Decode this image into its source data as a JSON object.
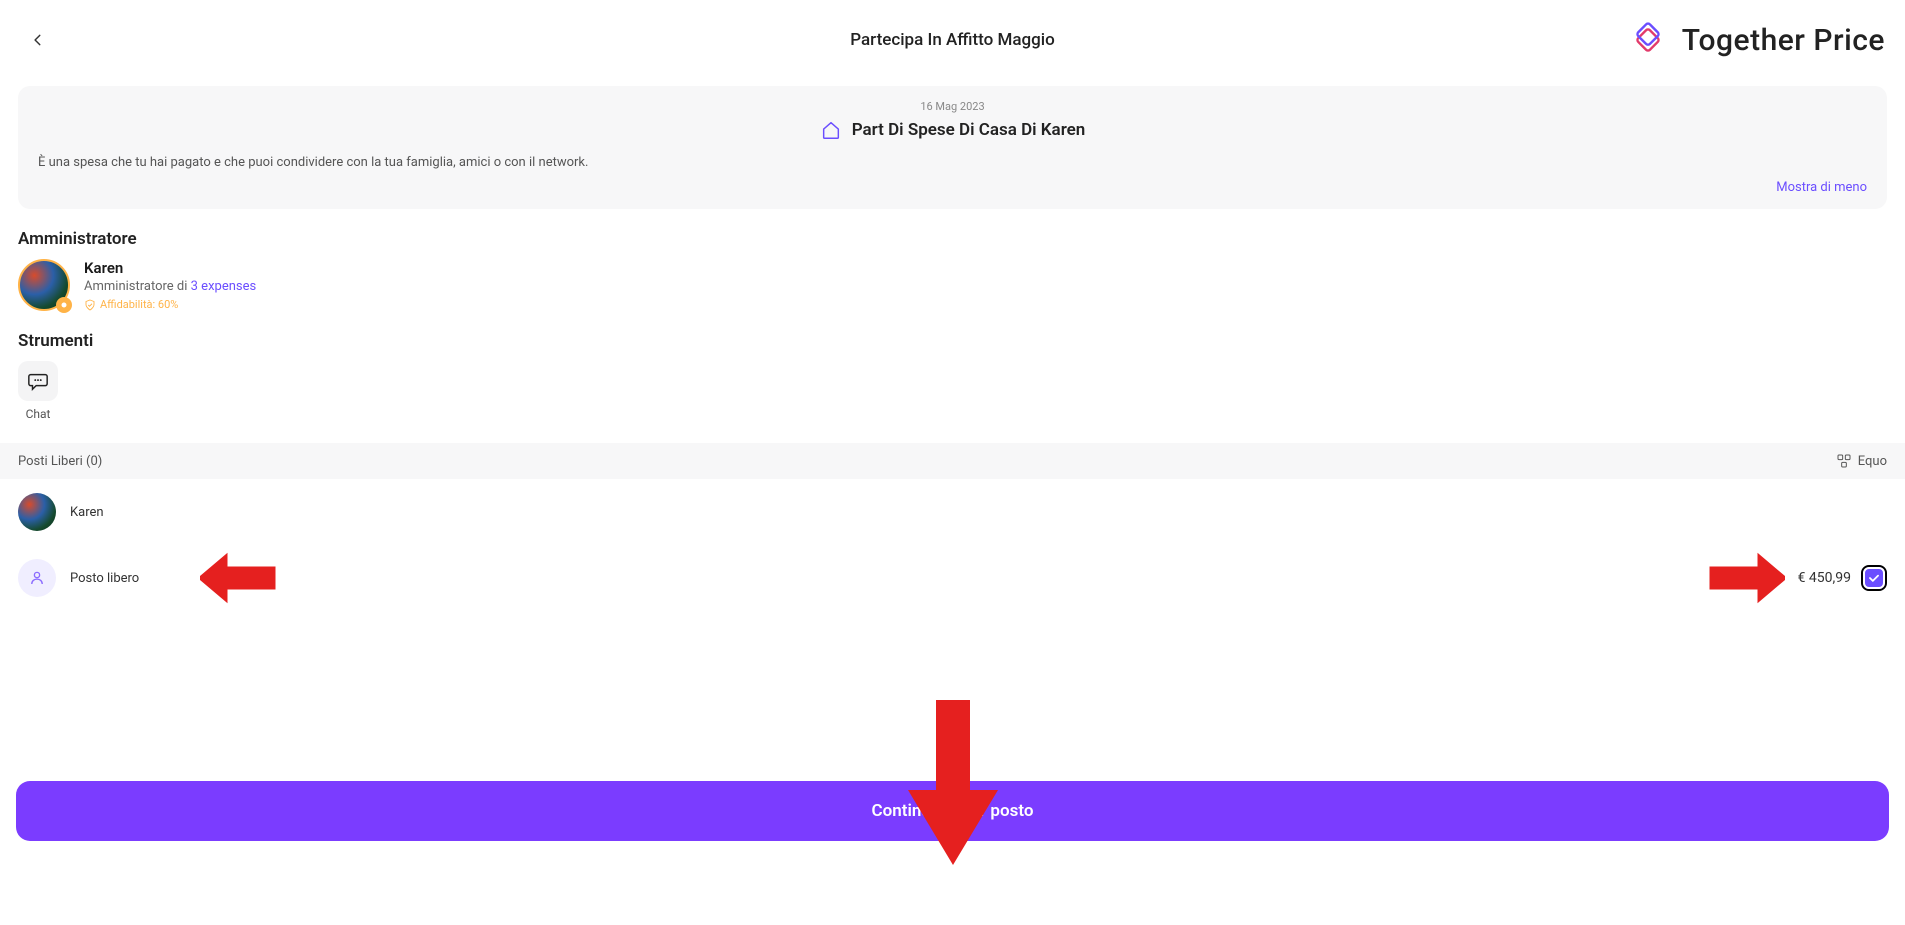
{
  "header": {
    "title": "Partecipa In Affitto Maggio",
    "brand": "Together Price"
  },
  "info_card": {
    "date": "16 Mag 2023",
    "title": "Part Di Spese Di Casa Di Karen",
    "description": "È una spesa che tu hai pagato e che puoi condividere con la tua famiglia, amici o con il network.",
    "show_less": "Mostra di meno"
  },
  "admin_section": {
    "heading": "Amministratore",
    "name": "Karen",
    "subtitle_prefix": "Amministratore di ",
    "subtitle_link": "3 expenses",
    "trust_label": "Affidabilità: 60%"
  },
  "tools_section": {
    "heading": "Strumenti",
    "chat_label": "Chat"
  },
  "seats": {
    "header_label": "Posti Liberi (0)",
    "distribution_label": "Equo",
    "rows": [
      {
        "name": "Karen",
        "price": "",
        "selected": false,
        "empty": false
      },
      {
        "name": "Posto libero",
        "price": "€ 450,99",
        "selected": true,
        "empty": true
      }
    ]
  },
  "cta": {
    "label": "Continua con 1 posto"
  }
}
